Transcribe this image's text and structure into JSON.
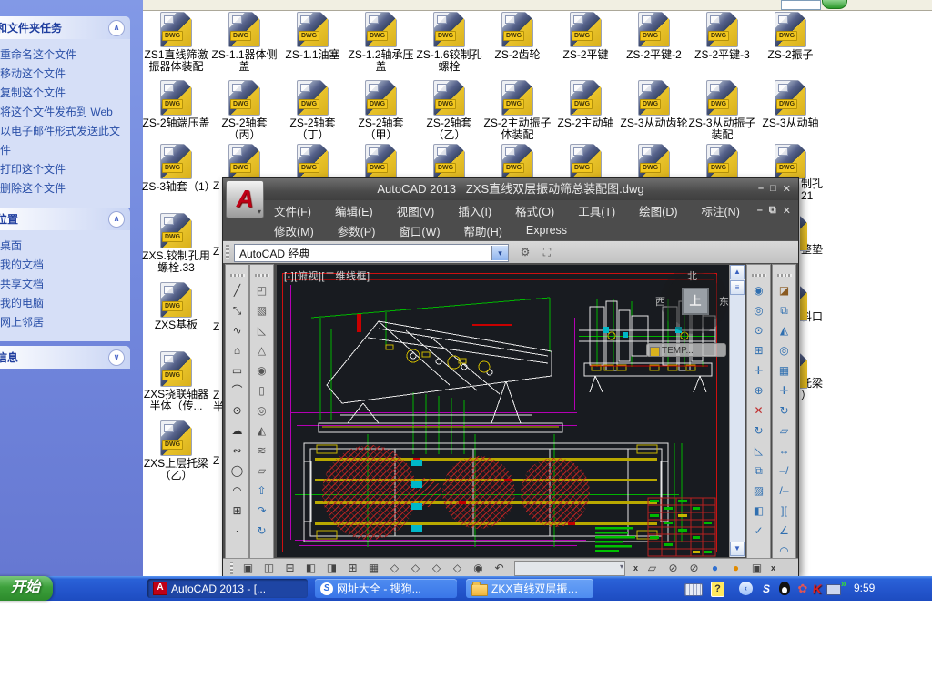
{
  "explorer": {
    "sidebar": {
      "tasks": {
        "title": "和文件夹任务",
        "items": [
          "重命名这个文件",
          "移动这个文件",
          "复制这个文件",
          "将这个文件发布到 Web",
          "以电子邮件形式发送此文件",
          "打印这个文件",
          "删除这个文件"
        ]
      },
      "places": {
        "title": "位置",
        "items": [
          "桌面",
          "我的文档",
          "共享文档",
          "我的电脑",
          "网上邻居"
        ]
      },
      "details": {
        "title": "信息"
      }
    },
    "files": {
      "filetype": "DWG",
      "row1": [
        "ZS1直线筛激振器体装配",
        "ZS-1.1器体侧盖",
        "ZS-1.1油塞",
        "ZS-1.2轴承压盖",
        "ZS-1.6铰制孔螺栓",
        "ZS-2齿轮",
        "ZS-2平键",
        "ZS-2平键-2",
        "ZS-2平键-3",
        "ZS-2振子"
      ],
      "row2": [
        "ZS-2轴端压盖",
        "ZS-2轴套（丙）",
        "ZS-2轴套（丁）",
        "ZS-2轴套（甲）",
        "ZS-2轴套（乙）",
        "ZS-2主动振子体装配",
        "ZS-2主动轴",
        "ZS-3从动齿轮",
        "ZS-3从动振子装配",
        "ZS-3从动轴"
      ],
      "row3_icons": [
        "",
        "",
        "",
        "",
        "",
        "",
        "",
        "",
        ""
      ],
      "col1": [
        "ZS-3轴套（1）",
        "ZXS.铰制孔用螺栓.33",
        "ZXS基板",
        "ZXS挠联轴器半体（传...",
        "ZXS上层托梁（乙）"
      ],
      "right_partials": [
        {
          "l1": "制孔",
          "l2": "21"
        },
        {
          "l1": "整垫",
          "l2": ""
        },
        {
          "l1": "料口",
          "l2": ""
        },
        {
          "l1": "托梁",
          "l2": "）"
        }
      ],
      "col2_partials": [
        {
          "l1": "Z",
          "l2": ""
        },
        {
          "l1": "Z",
          "l2": ""
        },
        {
          "l1": "Z",
          "l2": ""
        },
        {
          "l1": "Z",
          "l2": "半"
        },
        {
          "l1": "Z",
          "l2": ""
        }
      ]
    }
  },
  "autocad": {
    "app_button": "A",
    "title": "AutoCAD 2013   ZXS直线双层振动筛总装配图.dwg",
    "win_min": "–",
    "win_max": "□",
    "win_close": "✕",
    "doc_min": "–",
    "doc_restore": "⧉",
    "doc_close": "✕",
    "menus_row1": [
      "文件(F)",
      "编辑(E)",
      "视图(V)",
      "插入(I)",
      "格式(O)",
      "工具(T)",
      "绘图(D)",
      "标注(N)"
    ],
    "menus_row2": [
      "修改(M)",
      "参数(P)",
      "窗口(W)",
      "帮助(H)",
      "Express"
    ],
    "workspace_combo": "AutoCAD 经典",
    "combo_arrow": "▾",
    "viewport_label": "[-][俯视][二维线框]",
    "viewcube": {
      "north": "北",
      "west": "西",
      "east": "东",
      "top": "上"
    },
    "temp_tooltip": "TEMP...",
    "scroll_up": "▲",
    "scroll_thumb": "≡",
    "scroll_down": "▼",
    "toolbars": {
      "draw": [
        {
          "name": "line",
          "glyph": "╱"
        },
        {
          "name": "construction-line",
          "glyph": "⤡"
        },
        {
          "name": "polyline",
          "glyph": "∿"
        },
        {
          "name": "polygon",
          "glyph": "⌂"
        },
        {
          "name": "rectangle",
          "glyph": "▭"
        },
        {
          "name": "arc",
          "glyph": "⌒"
        },
        {
          "name": "circle",
          "glyph": "⊙"
        },
        {
          "name": "revision-cloud",
          "glyph": "☁"
        },
        {
          "name": "spline",
          "glyph": "∾"
        },
        {
          "name": "ellipse",
          "glyph": "◯"
        },
        {
          "name": "ellipse-arc",
          "glyph": "◠"
        },
        {
          "name": "insert-block",
          "glyph": "⊞"
        },
        {
          "name": "point",
          "glyph": "∙"
        }
      ],
      "modeling": [
        {
          "name": "polysolid",
          "glyph": "◰"
        },
        {
          "name": "box",
          "glyph": "▧"
        },
        {
          "name": "wedge",
          "glyph": "◺"
        },
        {
          "name": "cone",
          "glyph": "△"
        },
        {
          "name": "sphere",
          "glyph": "◉"
        },
        {
          "name": "cylinder",
          "glyph": "▯"
        },
        {
          "name": "torus",
          "glyph": "◎"
        },
        {
          "name": "pyramid",
          "glyph": "◭"
        },
        {
          "name": "helix",
          "glyph": "≋"
        },
        {
          "name": "planar-surface",
          "glyph": "▱"
        },
        {
          "name": "press-pull",
          "glyph": "⇧",
          "color": "#2f6fb0"
        },
        {
          "name": "sweep",
          "glyph": "↷",
          "color": "#2f6fb0"
        },
        {
          "name": "revolve",
          "glyph": "↻",
          "color": "#2f6fb0"
        }
      ],
      "solid_editing": [
        {
          "name": "union",
          "glyph": "◉"
        },
        {
          "name": "subtract",
          "glyph": "◎"
        },
        {
          "name": "intersect",
          "glyph": "⊙"
        },
        {
          "name": "extrude-faces",
          "glyph": "⊞"
        },
        {
          "name": "move-faces",
          "glyph": "✛"
        },
        {
          "name": "offset-faces",
          "glyph": "⊕"
        },
        {
          "name": "delete-faces",
          "glyph": "✕",
          "color": "#c03030"
        },
        {
          "name": "rotate-faces",
          "glyph": "↻"
        },
        {
          "name": "taper-faces",
          "glyph": "◺"
        },
        {
          "name": "copy-faces",
          "glyph": "⧉"
        },
        {
          "name": "color-faces",
          "glyph": "▨"
        },
        {
          "name": "shell",
          "glyph": "◧"
        },
        {
          "name": "check",
          "glyph": "✓"
        }
      ],
      "modify": [
        {
          "name": "erase",
          "glyph": "◪",
          "color": "#8a5a20"
        },
        {
          "name": "copy",
          "glyph": "⧉"
        },
        {
          "name": "mirror",
          "glyph": "◭"
        },
        {
          "name": "offset",
          "glyph": "◎"
        },
        {
          "name": "array",
          "glyph": "▦"
        },
        {
          "name": "move",
          "glyph": "✛"
        },
        {
          "name": "rotate",
          "glyph": "↻"
        },
        {
          "name": "scale",
          "glyph": "▱"
        },
        {
          "name": "stretch",
          "glyph": "↔"
        },
        {
          "name": "trim",
          "glyph": "–/"
        },
        {
          "name": "extend",
          "glyph": "/–"
        },
        {
          "name": "break",
          "glyph": "]["
        },
        {
          "name": "chamfer",
          "glyph": "∠"
        },
        {
          "name": "fillet",
          "glyph": "◠"
        }
      ],
      "bottom": [
        {
          "name": "named-views",
          "glyph": "▣"
        },
        {
          "name": "view-top",
          "glyph": "◫"
        },
        {
          "name": "view-bottom",
          "glyph": "⊟"
        },
        {
          "name": "view-left",
          "glyph": "◧"
        },
        {
          "name": "view-right",
          "glyph": "◨"
        },
        {
          "name": "view-front",
          "glyph": "⊞"
        },
        {
          "name": "view-back",
          "glyph": "▦"
        },
        {
          "name": "iso-sw",
          "glyph": "◇"
        },
        {
          "name": "iso-se",
          "glyph": "◇"
        },
        {
          "name": "iso-ne",
          "glyph": "◇"
        },
        {
          "name": "iso-nw",
          "glyph": "◇"
        },
        {
          "name": "camera",
          "glyph": "◉"
        },
        {
          "name": "previous-view",
          "glyph": "↶"
        }
      ],
      "render": [
        {
          "name": "render-region",
          "glyph": "▱"
        },
        {
          "name": "fog",
          "glyph": "⊘"
        },
        {
          "name": "adv-render-settings",
          "glyph": "⊘"
        },
        {
          "name": "materials",
          "glyph": "●",
          "color": "#2f6fd0"
        },
        {
          "name": "lights",
          "glyph": "●",
          "color": "#e08a00"
        },
        {
          "name": "render",
          "glyph": "▣"
        }
      ]
    }
  },
  "taskbar": {
    "start": "开始",
    "tasks": [
      "AutoCAD 2013 - [...",
      "网址大全 - 搜狗...",
      "ZKX直线双层振动筛"
    ],
    "task_icons": [
      "autocad",
      "sogou-browser",
      "folder"
    ],
    "tray": {
      "help": "?",
      "collapse": "‹",
      "sogou": "S",
      "antivirus": "✿",
      "kaspersky": "K",
      "time": "9:59"
    }
  }
}
